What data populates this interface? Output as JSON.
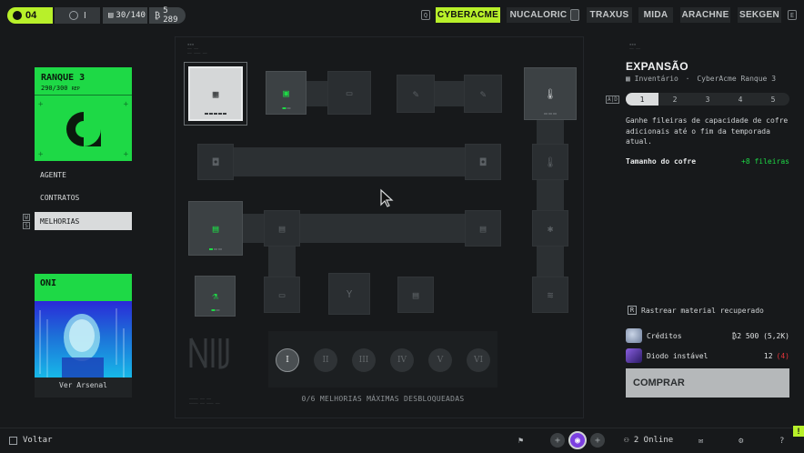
{
  "topbar": {
    "level": "04",
    "rank_roman": "I",
    "storage": "30/140",
    "currency": "5 289",
    "brand_key_left": "Q",
    "brand_key_right": "E",
    "brands": [
      "CYBERACME",
      "NUCALORIC",
      "TRAXUS",
      "MIDA",
      "ARACHNE",
      "SEKGEN"
    ],
    "active_brand": "CYBERACME"
  },
  "left": {
    "rank_title": "RANQUE 3",
    "rank_rep": "290/300",
    "rank_rep_unit": "REP",
    "menu": [
      "AGENTE",
      "CONTRATOS",
      "MELHORIAS"
    ],
    "menu_keys": [
      "W",
      "S"
    ],
    "oni_title": "ONI",
    "oni_label": "Ver Arsenal"
  },
  "board": {
    "tiers": [
      "I",
      "II",
      "III",
      "IV",
      "V",
      "VI"
    ],
    "active_tier": "I",
    "status": "0/6 MELHORIAS MÁXIMAS DESBLOQUEADAS",
    "node_icons": [
      "grid-icon",
      "vault-icon",
      "cash-icon",
      "pencil-icon",
      "pencil-icon",
      "thermo-up-icon",
      "canister-icon",
      "canister-icon",
      "thermo-icon",
      "card-icon",
      "card-icon",
      "card-icon",
      "chip-icon",
      "flask-icon",
      "cash-icon",
      "goblet-icon",
      "card-icon",
      "stack-icon"
    ]
  },
  "right": {
    "title": "EXPANSÃO",
    "breadcrumb_1": "Inventário",
    "breadcrumb_2": "CyberAcme Ranque 3",
    "level_keys": "A|D",
    "levels": [
      "1",
      "2",
      "3",
      "4",
      "5"
    ],
    "active_level": "1",
    "description": "Ganhe fileiras de capacidade de cofre adicionais até o fim da temporada atual.",
    "stat_label": "Tamanho do cofre",
    "stat_value": "+8 fileiras",
    "track_key": "R",
    "track_label": "Rastrear material recuperado",
    "costs": [
      {
        "name": "Créditos",
        "amount": "2 500 (5,2K)",
        "missing": ""
      },
      {
        "name": "Diodo instável",
        "amount": "12",
        "missing": "(4)"
      }
    ],
    "buy_label": "COMPRAR"
  },
  "bottom": {
    "back_label": "Voltar",
    "online_label": "2 Online",
    "notice": "!"
  },
  "colors": {
    "accent": "#b8f02a",
    "rank_green": "#1ed946",
    "warning_red": "#e5343a"
  }
}
